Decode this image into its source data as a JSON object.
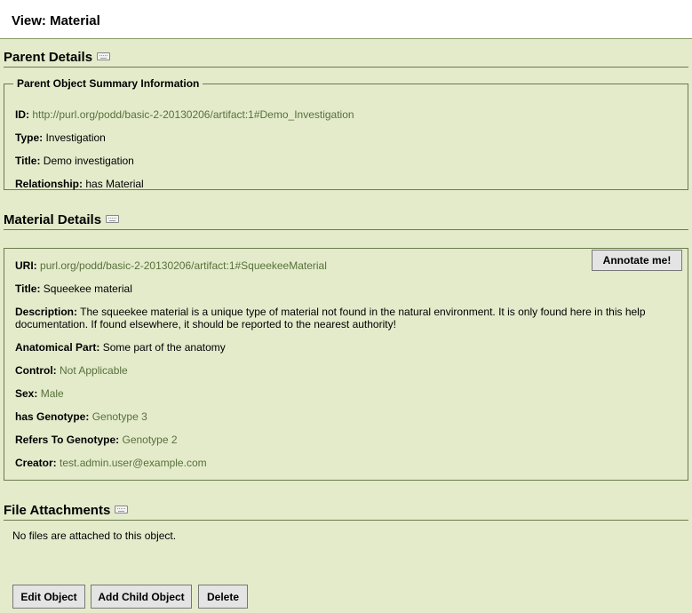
{
  "header": {
    "title": "View: Material"
  },
  "parent_details": {
    "heading": "Parent Details",
    "legend": "Parent Object Summary Information",
    "id_label": "ID:",
    "id_value": "http://purl.org/podd/basic-2-20130206/artifact:1#Demo_Investigation",
    "type_label": "Type:",
    "type_value": "Investigation",
    "title_label": "Title:",
    "title_value": "Demo investigation",
    "relationship_label": "Relationship:",
    "relationship_value": "has Material"
  },
  "material_details": {
    "heading": "Material Details",
    "annotate_label": "Annotate me!",
    "uri_label": "URI:",
    "uri_value": "purl.org/podd/basic-2-20130206/artifact:1#SqueekeeMaterial",
    "title_label": "Title:",
    "title_value": "Squeekee material",
    "description_label": "Description:",
    "description_value": "The squeekee material is a unique type of material not found in the natural environment. It is only found here in this help documentation. If found elsewhere, it should be reported to the nearest authority!",
    "anatomical_label": "Anatomical Part:",
    "anatomical_value": "Some part of the anatomy",
    "control_label": "Control:",
    "control_value": "Not Applicable",
    "sex_label": "Sex:",
    "sex_value": "Male",
    "genotype_label": "has Genotype:",
    "genotype_value": "Genotype 3",
    "refers_label": "Refers To Genotype:",
    "refers_value": "Genotype 2",
    "creator_label": "Creator:",
    "creator_value": "test.admin.user@example.com"
  },
  "file_attachments": {
    "heading": "File Attachments",
    "empty_message": "No files are attached to this object."
  },
  "actions": {
    "edit_label": "Edit Object",
    "add_child_label": "Add Child Object",
    "delete_label": "Delete"
  },
  "colors": {
    "background": "#e3ebcb",
    "link": "#58703a",
    "border": "#6b7a4f"
  },
  "icons": {
    "section_help": "keyboard-icon"
  }
}
